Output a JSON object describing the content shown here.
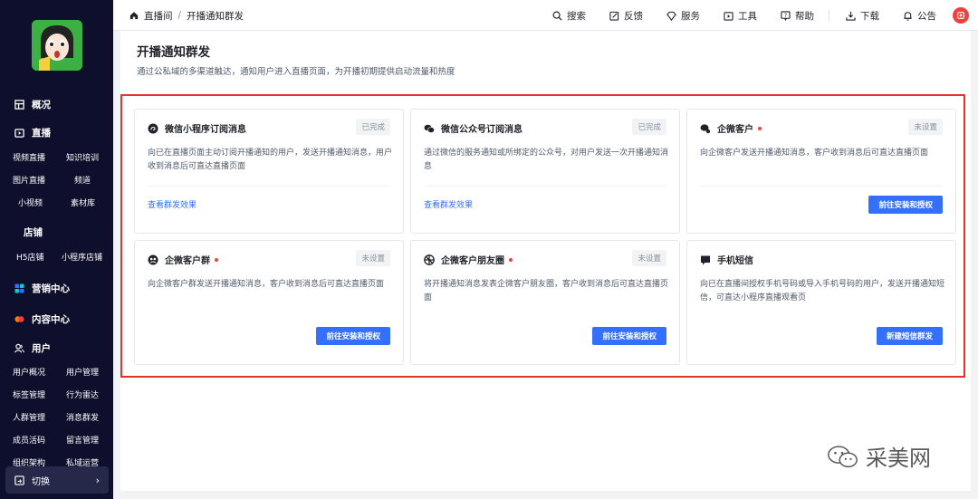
{
  "sidebar": {
    "sections": [
      {
        "label": "概况"
      },
      {
        "label": "直播",
        "items": [
          "视频直播",
          "知识培训",
          "图片直播",
          "频道",
          "小视频",
          "素材库"
        ]
      },
      {
        "label": "店铺",
        "items": [
          "H5店铺",
          "小程序店铺"
        ]
      },
      {
        "label": "营销中心"
      },
      {
        "label": "内容中心"
      },
      {
        "label": "用户",
        "items": [
          "用户概况",
          "用户管理",
          "标签管理",
          "行为雷达",
          "人群管理",
          "消息群发",
          "成员活码",
          "留言管理",
          "组织架构",
          "私域运营"
        ]
      }
    ],
    "switch_label": "切换"
  },
  "topbar": {
    "breadcrumb": [
      "直播间",
      "开播通知群发"
    ],
    "tools": [
      "搜索",
      "反馈",
      "服务",
      "工具",
      "帮助",
      "下载",
      "公告"
    ]
  },
  "page": {
    "title": "开播通知群发",
    "description": "通过公私域的多渠道触达，通知用户进入直播页面，为开播初期提供启动流量和热度"
  },
  "cards": [
    {
      "title": "微信小程序订阅消息",
      "status": "已完成",
      "desc": "向已在直播页面主动订阅开播通知的用户，发送开播通知消息，用户收到消息后可直达直播页面",
      "link": "查看群发效果",
      "icon": "mini-program-icon"
    },
    {
      "title": "微信公众号订阅消息",
      "status": "已完成",
      "desc": "通过微信的服务通知或所绑定的公众号，对用户发送一次开播通知消息",
      "link": "查看群发效果",
      "icon": "wechat-icon"
    },
    {
      "title": "企微客户",
      "status": "未设置",
      "desc": "向企微客户发送开播通知消息，客户收到消息后可直达直播页面",
      "button": "前往安装和授权",
      "icon": "wecom-icon",
      "required": true
    },
    {
      "title": "企微客户群",
      "status": "未设置",
      "desc": "向企微客户群发送开播通知消息，客户收到消息后可直达直播页面",
      "button": "前往安装和授权",
      "icon": "group-icon",
      "required": true
    },
    {
      "title": "企微客户朋友圈",
      "status": "未设置",
      "desc": "将开播通知消息发表企微客户朋友圈，客户收到消息后可直达直播页面",
      "button": "前往安装和授权",
      "icon": "moments-icon",
      "required": true
    },
    {
      "title": "手机短信",
      "desc": "向已在直播间授权手机号码或导入手机号码的用户，发送开播通知短信，可直达小程序直播观看页",
      "button": "新建短信群发",
      "icon": "sms-icon"
    }
  ],
  "watermark": "采美网"
}
